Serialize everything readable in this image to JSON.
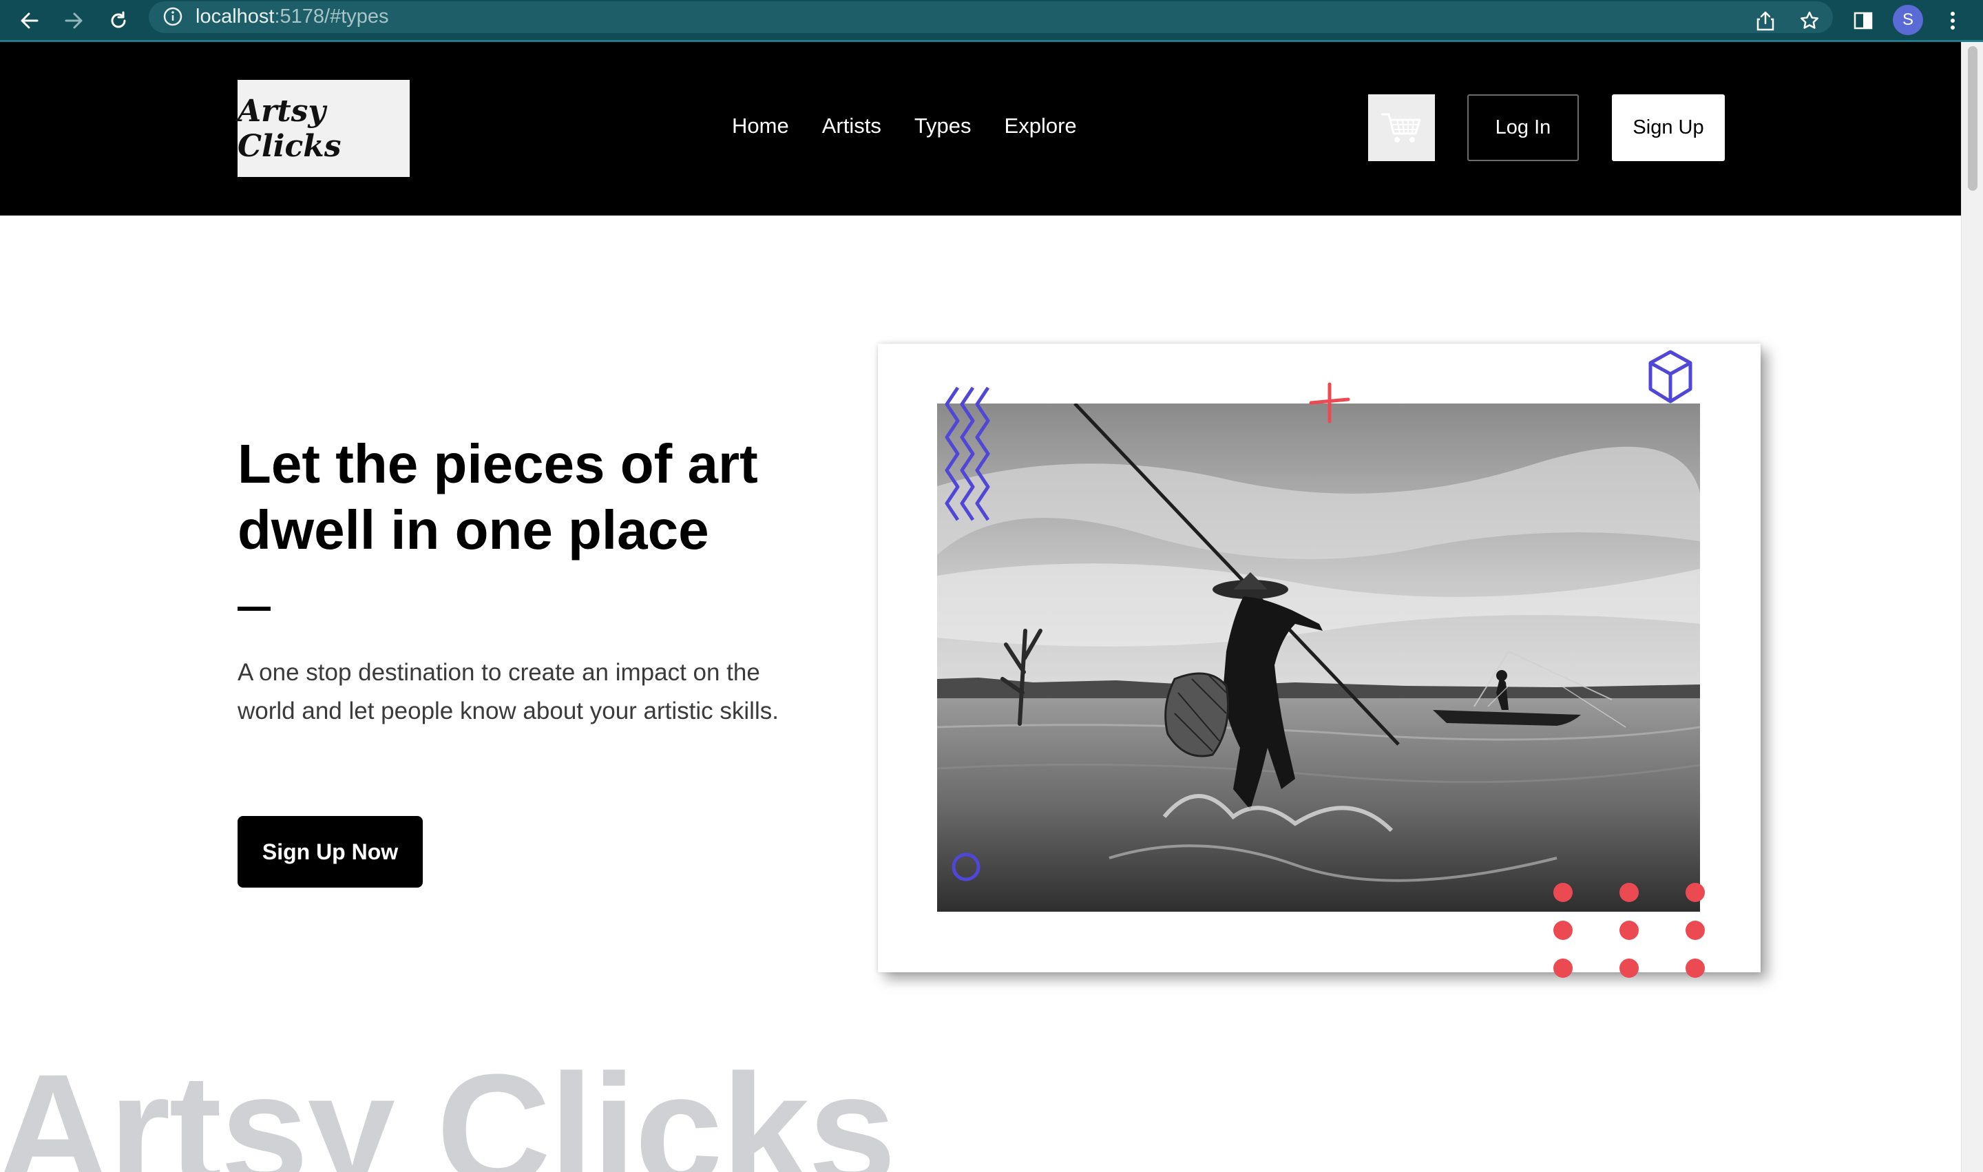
{
  "browser": {
    "url_host": "localhost",
    "url_rest": ":5178/#types",
    "profile_initial": "S"
  },
  "header": {
    "logo_text": "Artsy Clicks",
    "nav": [
      "Home",
      "Artists",
      "Types",
      "Explore"
    ],
    "login_label": "Log In",
    "signup_label": "Sign Up"
  },
  "hero": {
    "title_line1": "Let the pieces of art",
    "title_line2": "dwell in one place",
    "description": "A one stop destination to create an impact on the world and let people know about your artistic skills.",
    "cta_label": "Sign Up Now"
  },
  "watermark": "Artsy Clicks",
  "colors": {
    "chrome": "#0f4c56",
    "accent_blue": "#5046d8",
    "accent_red": "#ec4a52"
  }
}
